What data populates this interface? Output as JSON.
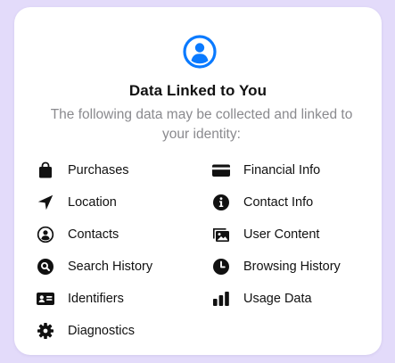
{
  "header": {
    "title": "Data Linked to You",
    "subtitle": "The following data may be collected and linked to your identity:"
  },
  "colors": {
    "background": "#e3dbfa",
    "card": "#ffffff",
    "accent": "#0a7aff",
    "text": "#111111",
    "secondary_text": "#8a8a8e"
  },
  "items": [
    {
      "label": "Purchases",
      "icon": "shopping-bag-icon"
    },
    {
      "label": "Financial Info",
      "icon": "credit-card-icon"
    },
    {
      "label": "Location",
      "icon": "location-arrow-icon"
    },
    {
      "label": "Contact Info",
      "icon": "info-circle-icon"
    },
    {
      "label": "Contacts",
      "icon": "person-circle-icon"
    },
    {
      "label": "User Content",
      "icon": "photos-icon"
    },
    {
      "label": "Search History",
      "icon": "search-circle-icon"
    },
    {
      "label": "Browsing History",
      "icon": "clock-icon"
    },
    {
      "label": "Identifiers",
      "icon": "id-card-icon"
    },
    {
      "label": "Usage Data",
      "icon": "bar-chart-icon"
    },
    {
      "label": "Diagnostics",
      "icon": "gear-icon"
    }
  ]
}
